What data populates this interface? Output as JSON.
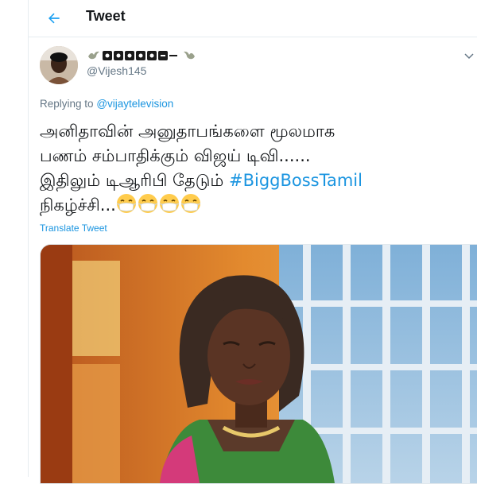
{
  "header": {
    "title": "Tweet",
    "back_icon": "arrow-left-icon"
  },
  "tweet": {
    "display_name_icons": [
      "dove-icon",
      "blocked-letters",
      "dove-icon"
    ],
    "handle": "@Vijesh145",
    "replying_prefix": "Replying to",
    "replying_to": "@vijaytelevision",
    "text_lines": [
      "அனிதாவின் அனுதாபங்களை மூலமாக",
      "பணம் சம்பாதிக்கும் விஜய் டிவி......",
      "இதிலும் டிஆரிபி தேடும்",
      "நிகழ்ச்சி..."
    ],
    "hashtag": "#BiggBossTamil",
    "emoji_count": 4,
    "emoji_name": "face-with-medical-mask-icon",
    "translate_label": "Translate Tweet",
    "media_image_name": "tweet-photo"
  },
  "colors": {
    "accent": "#1b95e0",
    "text": "#14171a",
    "secondary": "#657786",
    "border": "#e6ecf0"
  }
}
